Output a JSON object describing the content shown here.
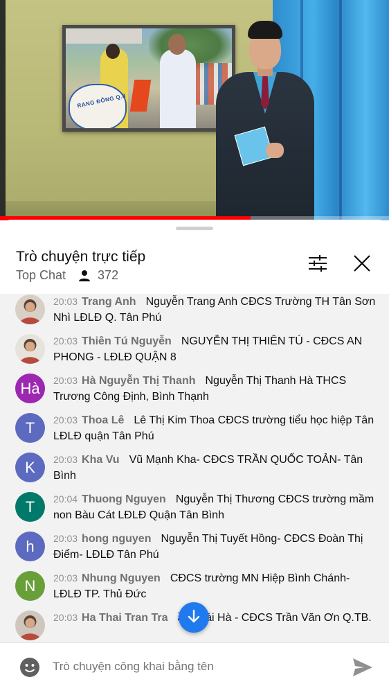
{
  "video": {
    "news_banner_text": "RẠNG ĐÔNG Q.8",
    "progress": 0.645
  },
  "chat": {
    "title": "Trò chuyện trực tiếp",
    "mode": "Top Chat",
    "viewer_count": "372",
    "icons": {
      "viewers": "person-icon",
      "filter": "sliders-icon",
      "close": "close-icon",
      "scroll_down": "arrow-down-icon",
      "emoji": "emoji-icon",
      "send": "send-icon"
    },
    "messages": [
      {
        "time": "20:03",
        "author": "Trang Anh",
        "text": "Nguyễn Trang Anh CĐCS Trường TH Tân Sơn Nhì LĐLĐ Q. Tân Phú",
        "avatar_type": "photo",
        "avatar_letter": "",
        "avatar_color": "#d8cfc6"
      },
      {
        "time": "20:03",
        "author": "Thiên Tú Nguyễn",
        "text": "NGUYỄN THỊ THIÊN TÚ - CĐCS AN PHONG - LĐLĐ QUẬN 8",
        "avatar_type": "photo",
        "avatar_letter": "",
        "avatar_color": "#e6e2dc"
      },
      {
        "time": "20:03",
        "author": "Hà Nguyễn Thị Thanh",
        "text": "Nguyễn Thị Thanh Hà THCS Trương Công Định, Bình Thạnh",
        "avatar_type": "letter",
        "avatar_letter": "Hà",
        "avatar_color": "#9c27b0"
      },
      {
        "time": "20:03",
        "author": "Thoa Lê",
        "text": "Lê Thị Kim Thoa CĐCS trường tiểu học hiệp Tân LĐLĐ quận Tân Phú",
        "avatar_type": "letter",
        "avatar_letter": "T",
        "avatar_color": "#5c6bc0"
      },
      {
        "time": "20:03",
        "author": "Kha Vu",
        "text": "Vũ Mạnh Kha- CĐCS TRẦN QUỐC TOẢN- Tân Bình",
        "avatar_type": "letter",
        "avatar_letter": "K",
        "avatar_color": "#5c6bc0"
      },
      {
        "time": "20:04",
        "author": "Thuong Nguyen",
        "text": "Nguyễn Thị Thương CĐCS trường mầm non Bàu Cát LĐLĐ Quận Tân Bình",
        "avatar_type": "letter",
        "avatar_letter": "T",
        "avatar_color": "#00796b"
      },
      {
        "time": "20:03",
        "author": "hong nguyen",
        "text": "Nguyễn Thị Tuyết Hồng- CĐCS Đoàn Thị Điểm- LĐLĐ Tân Phú",
        "avatar_type": "letter",
        "avatar_letter": "h",
        "avatar_color": "#5c6bc0"
      },
      {
        "time": "20:03",
        "author": "Nhung Nguyen",
        "text": "CĐCS trường MN Hiệp Bình Chánh- LĐLĐ TP. Thủ Đức",
        "avatar_type": "letter",
        "avatar_letter": "N",
        "avatar_color": "#689f38"
      },
      {
        "time": "20:03",
        "author": "Ha Thai Tran Tra",
        "text": "ần Thái Hà - CĐCS Trần Văn Ơn Q.TB.",
        "avatar_type": "photo",
        "avatar_letter": "",
        "avatar_color": "#cfc7bd"
      }
    ],
    "composer": {
      "placeholder": "Trò chuyện công khai bằng tên"
    }
  },
  "colors": {
    "accent": "#1f7af0",
    "progress": "#ff0000"
  }
}
